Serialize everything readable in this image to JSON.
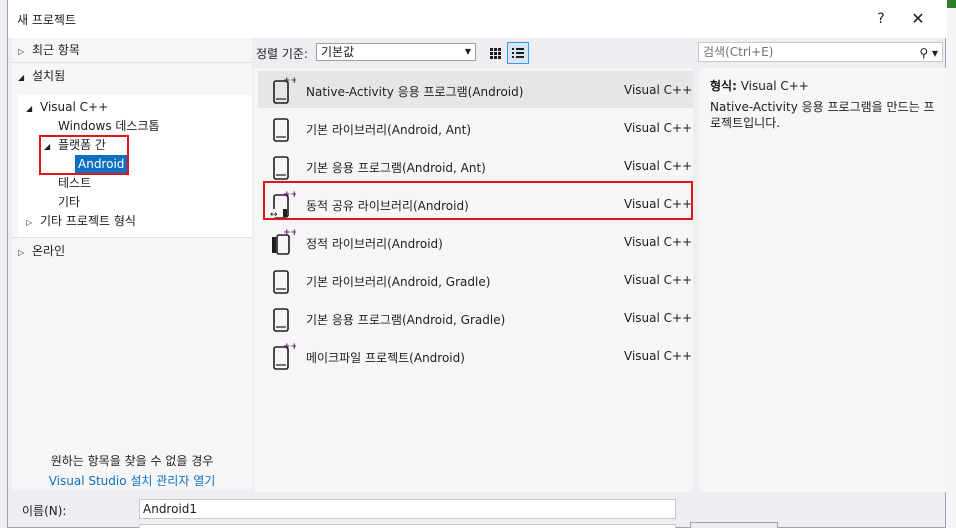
{
  "dialog": {
    "title": "새 프로젝트",
    "help": "?",
    "close": "✕"
  },
  "tree": {
    "recent": "최근 항목",
    "installed": "설치됨",
    "visual_cpp": "Visual C++",
    "windows_desktop": "Windows 데스크톱",
    "cross_platform": "플랫폼 간",
    "android": "Android",
    "test": "테스트",
    "other": "기타",
    "other_project_types": "기타 프로젝트 형식",
    "online": "온라인"
  },
  "hint": {
    "text": "원하는 항목을 찾을 수 없을 경우",
    "link": "Visual Studio 설치 관리자 열기"
  },
  "toolbar": {
    "sort_label": "정렬 기준:",
    "sort_value": "기본값",
    "search_placeholder": "검색(Ctrl+E)"
  },
  "templates": [
    {
      "name": "Native-Activity 응용 프로그램(Android)",
      "lang": "Visual C++",
      "icon": "native-activity-icon",
      "plus": true
    },
    {
      "name": "기본 라이브러리(Android, Ant)",
      "lang": "Visual C++",
      "icon": "library-icon",
      "plus": false
    },
    {
      "name": "기본 응용 프로그램(Android, Ant)",
      "lang": "Visual C++",
      "icon": "app-icon",
      "plus": false
    },
    {
      "name": "동적 공유 라이브러리(Android)",
      "lang": "Visual C++",
      "icon": "shared-library-icon",
      "plus": true
    },
    {
      "name": "정적 라이브러리(Android)",
      "lang": "Visual C++",
      "icon": "static-library-icon",
      "plus": true
    },
    {
      "name": "기본 라이브러리(Android, Gradle)",
      "lang": "Visual C++",
      "icon": "library-icon",
      "plus": false
    },
    {
      "name": "기본 응용 프로그램(Android, Gradle)",
      "lang": "Visual C++",
      "icon": "app-icon",
      "plus": false
    },
    {
      "name": "메이크파일 프로젝트(Android)",
      "lang": "Visual C++",
      "icon": "makefile-icon",
      "plus": true
    }
  ],
  "description": {
    "type_label": "형식:",
    "type_value": "Visual C++",
    "text": "Native-Activity 응용 프로그램을 만드는 프로젝트입니다."
  },
  "form": {
    "name_label": "이름(N):",
    "name_value": "Android1"
  },
  "colors": {
    "selection": "#0e70c0",
    "highlight_box": "#e3141c",
    "cpp_plus": "#68217a"
  }
}
